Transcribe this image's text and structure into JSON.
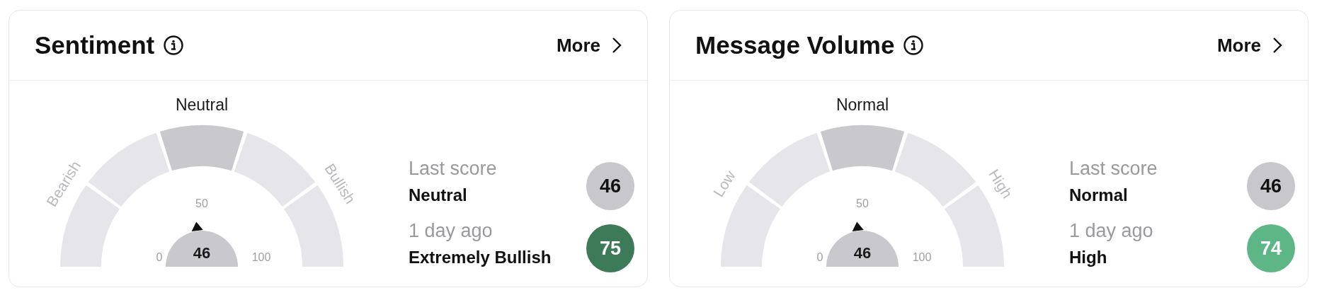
{
  "cards": [
    {
      "title": "Sentiment",
      "more": "More",
      "gauge": {
        "labels": {
          "low": "Bearish",
          "mid": "Neutral",
          "high": "Bullish"
        },
        "segments": [
          {
            "selected": false
          },
          {
            "selected": false
          },
          {
            "selected": true
          },
          {
            "selected": false
          },
          {
            "selected": false
          }
        ],
        "ticks": {
          "min": "0",
          "mid": "50",
          "max": "100"
        },
        "value": "46"
      },
      "readings": [
        {
          "caption": "Last score",
          "label": "Neutral",
          "score": "46",
          "color": "#c8c8cc"
        },
        {
          "caption": "1 day ago",
          "label": "Extremely Bullish",
          "score": "75",
          "color": "#3d7b58"
        }
      ]
    },
    {
      "title": "Message Volume",
      "more": "More",
      "gauge": {
        "labels": {
          "low": "Low",
          "mid": "Normal",
          "high": "High"
        },
        "segments": [
          {
            "selected": false
          },
          {
            "selected": false
          },
          {
            "selected": true
          },
          {
            "selected": false
          },
          {
            "selected": false
          }
        ],
        "ticks": {
          "min": "0",
          "mid": "50",
          "max": "100"
        },
        "value": "46"
      },
      "readings": [
        {
          "caption": "Last score",
          "label": "Normal",
          "score": "46",
          "color": "#c8c8cc"
        },
        {
          "caption": "1 day ago",
          "label": "High",
          "score": "74",
          "color": "#5db685"
        }
      ]
    }
  ]
}
